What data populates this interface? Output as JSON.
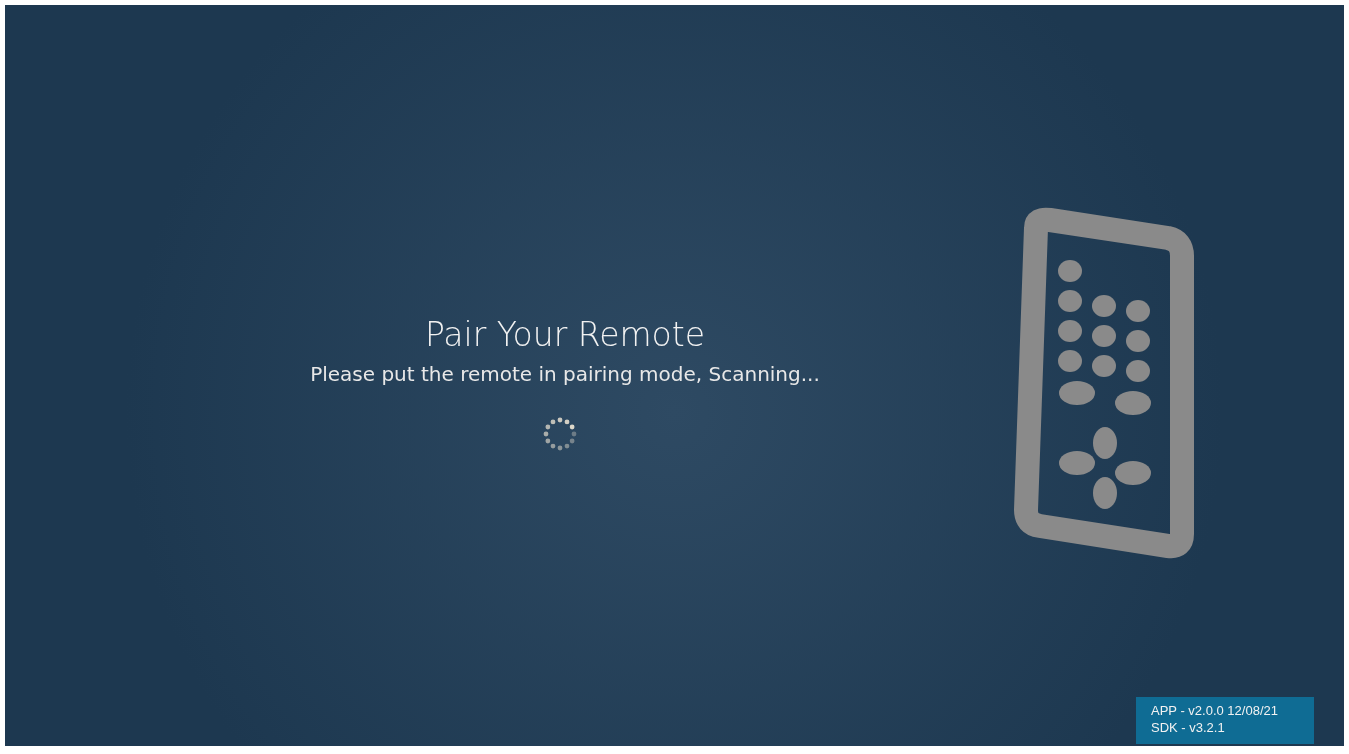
{
  "title": "Pair Your Remote",
  "message": "Please put the remote in pairing mode, Scanning...",
  "version_info": {
    "app": "APP - v2.0.0 12/08/21",
    "sdk": "SDK - v3.2.1"
  }
}
